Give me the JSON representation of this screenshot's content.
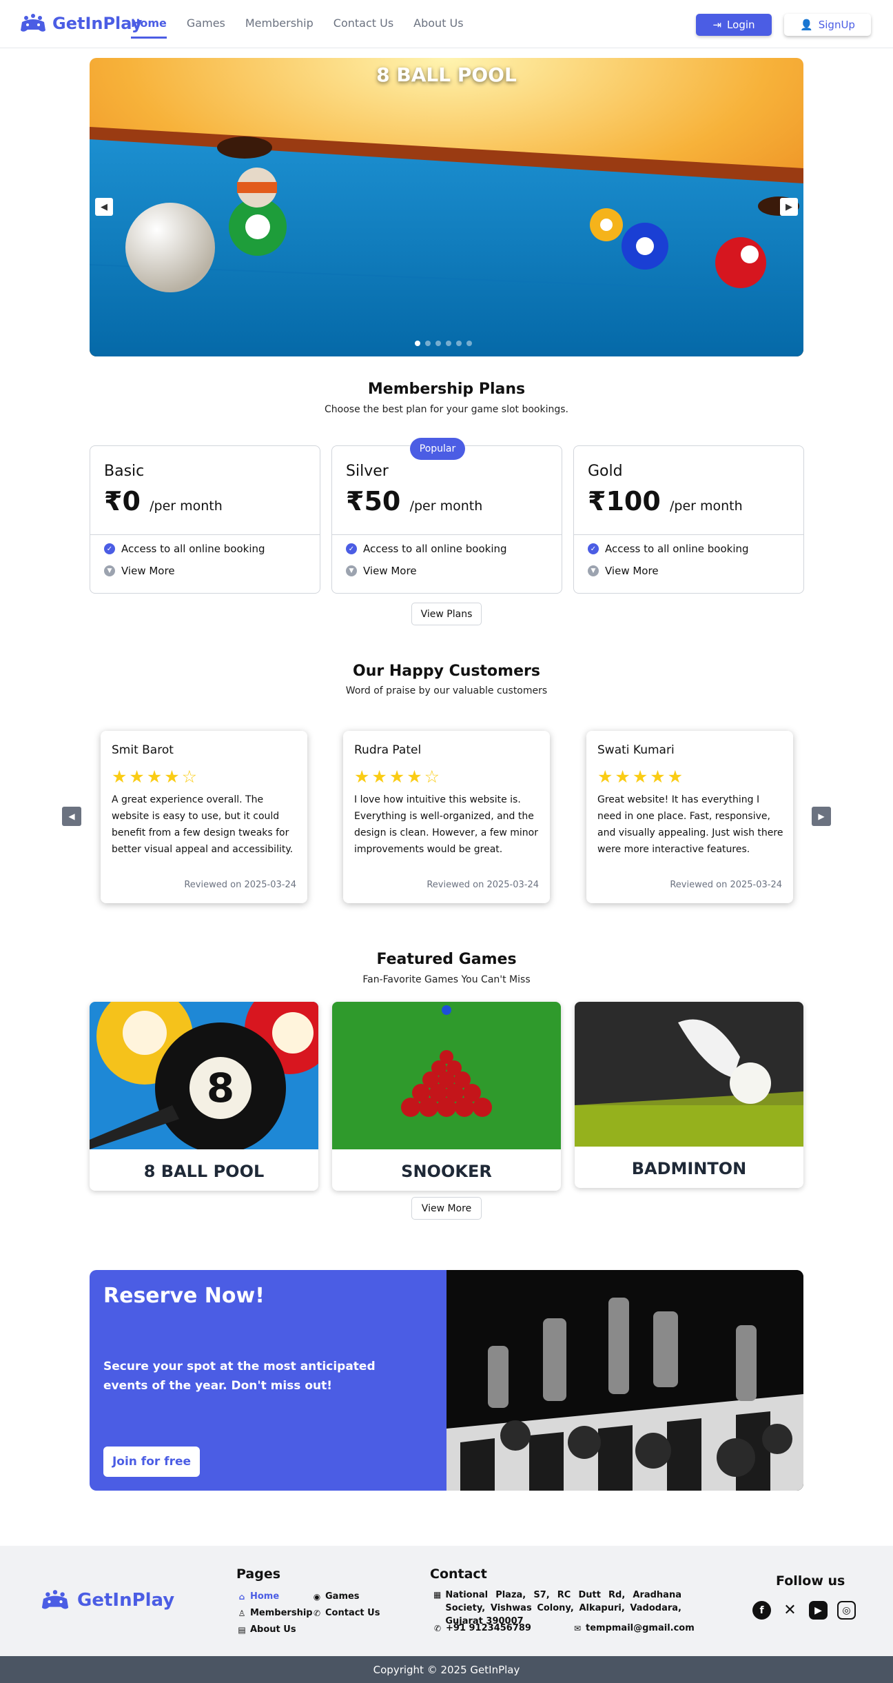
{
  "brand": {
    "name": "GetInPlay"
  },
  "nav": {
    "items": [
      {
        "label": "Home"
      },
      {
        "label": "Games"
      },
      {
        "label": "Membership"
      },
      {
        "label": "Contact Us"
      },
      {
        "label": "About Us"
      }
    ],
    "login": "Login",
    "signup": "SignUp"
  },
  "hero": {
    "title": "8 BALL POOL",
    "slide_count": 6,
    "active_slide": 1
  },
  "membership": {
    "title": "Membership Plans",
    "subtitle": "Choose the best plan for your game slot bookings.",
    "badge": "Popular",
    "plans": [
      {
        "name": "Basic",
        "price": "₹0",
        "period": "/per month",
        "feature": "Access to all online booking",
        "more": "View More"
      },
      {
        "name": "Silver",
        "price": "₹50",
        "period": "/per month",
        "feature": "Access to all online booking",
        "more": "View More"
      },
      {
        "name": "Gold",
        "price": "₹100",
        "period": "/per month",
        "feature": "Access to all online booking",
        "more": "View More"
      }
    ],
    "cta": "View Plans"
  },
  "reviews": {
    "title": "Our Happy Customers",
    "subtitle": "Word of praise by our valuable customers",
    "items": [
      {
        "name": "Smit Barot",
        "stars": "★★★★☆",
        "rating": 4,
        "text": "A great experience overall. The website is easy to use, but it could benefit from a few design tweaks for better visual appeal and accessibility.",
        "date": "Reviewed on 2025-03-24"
      },
      {
        "name": "Rudra Patel",
        "stars": "★★★★☆",
        "rating": 4,
        "text": "I love how intuitive this website is. Everything is well-organized, and the design is clean. However, a few minor improvements would be great.",
        "date": "Reviewed on 2025-03-24"
      },
      {
        "name": "Swati Kumari",
        "stars": "★★★★★",
        "rating": 5,
        "text": "Great website! It has everything I need in one place. Fast, responsive, and visually appealing. Just wish there were more interactive features.",
        "date": "Reviewed on 2025-03-24"
      }
    ]
  },
  "games": {
    "title": "Featured Games",
    "subtitle": "Fan-Favorite Games You Can't Miss",
    "items": [
      {
        "label": "8 BALL POOL"
      },
      {
        "label": "SNOOKER"
      },
      {
        "label": "BADMINTON"
      }
    ],
    "cta": "View More"
  },
  "reserve": {
    "title": "Reserve Now!",
    "text": "Secure your spot at the most anticipated events of the year. Don't miss out!",
    "cta": "Join for free"
  },
  "footer": {
    "pages_title": "Pages",
    "pages": [
      {
        "label": "Home",
        "icon": "home-icon"
      },
      {
        "label": "Games",
        "icon": "gamepad-icon"
      },
      {
        "label": "Membership",
        "icon": "badge-icon"
      },
      {
        "label": "Contact Us",
        "icon": "phone-icon"
      },
      {
        "label": "About Us",
        "icon": "id-card-icon"
      }
    ],
    "contact_title": "Contact",
    "address": "National Plaza, S7, RC Dutt Rd, Aradhana Society, Vishwas Colony, Alkapuri, Vadodara, Gujarat 390007",
    "phone": "+91 9123456789",
    "email": "tempmail@gmail.com",
    "follow_title": "Follow us",
    "social": [
      "facebook-icon",
      "x-icon",
      "youtube-icon",
      "instagram-icon"
    ],
    "copyright": "Copyright © 2025 GetInPlay"
  },
  "colors": {
    "accent": "#4b5de4",
    "star": "#facc15",
    "footer_bar": "#4b5563"
  }
}
